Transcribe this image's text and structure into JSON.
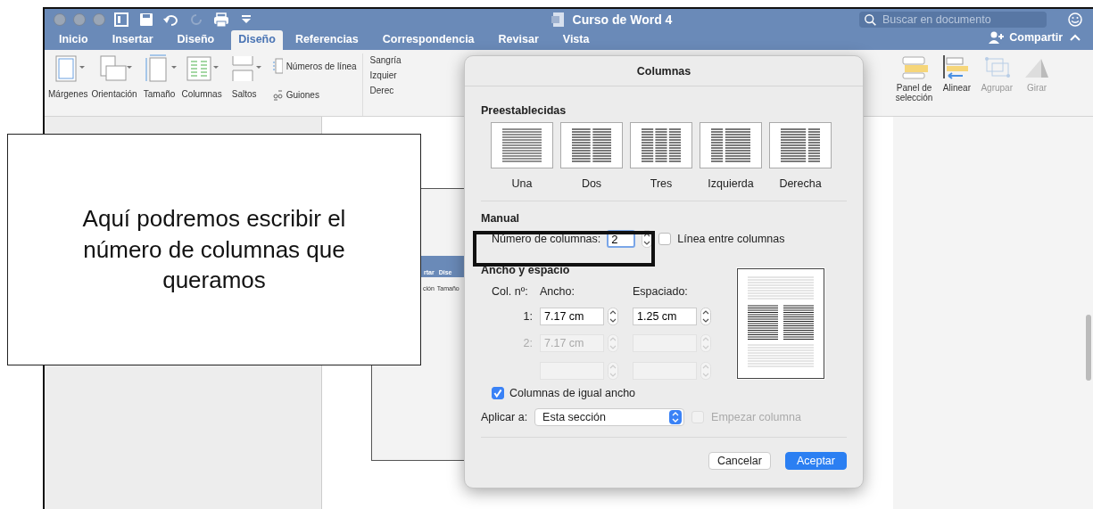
{
  "window": {
    "title": "Curso de Word 4",
    "search": {
      "placeholder": "Buscar en documento"
    },
    "share": "Compartir"
  },
  "tabs": [
    {
      "label": "Inicio",
      "selected": false
    },
    {
      "label": "Insertar",
      "selected": false
    },
    {
      "label": "Diseño",
      "selected": false
    },
    {
      "label": "Diseño",
      "selected": true
    },
    {
      "label": "Referencias",
      "selected": false
    },
    {
      "label": "Correspondencia",
      "selected": false
    },
    {
      "label": "Revisar",
      "selected": false
    },
    {
      "label": "Vista",
      "selected": false
    }
  ],
  "ribbon": {
    "large": [
      {
        "label": "Márgenes",
        "kind": "margins"
      },
      {
        "label": "Orientación",
        "kind": "orientation"
      },
      {
        "label": "Tamaño",
        "kind": "size"
      },
      {
        "label": "Columnas",
        "kind": "columns"
      },
      {
        "label": "Saltos",
        "kind": "breaks"
      }
    ],
    "small": [
      {
        "label": "Números de línea",
        "kind": "numbers"
      },
      {
        "label": "Guiones",
        "kind": "hyphen"
      }
    ],
    "indent": {
      "title": "Sangría",
      "items": [
        "Izquier",
        "Derec"
      ]
    },
    "right": [
      {
        "label": "Panel de selección",
        "kind": "panel",
        "disabled": false
      },
      {
        "label": "Alinear",
        "kind": "align",
        "disabled": false
      },
      {
        "label": "Agrupar",
        "kind": "group",
        "disabled": true
      },
      {
        "label": "Girar",
        "kind": "rotate",
        "disabled": true
      }
    ]
  },
  "inner_screenshot": {
    "tabs": [
      "rtar",
      "Dise"
    ],
    "labels": [
      "ción",
      "Tamaño"
    ]
  },
  "callout": {
    "text": "Aquí podremos escribir el número de columnas que queramos"
  },
  "dialog": {
    "title": "Columnas",
    "presets_title": "Preestablecidas",
    "presets": [
      {
        "label": "Una",
        "kind": "one"
      },
      {
        "label": "Dos",
        "kind": "two"
      },
      {
        "label": "Tres",
        "kind": "three"
      },
      {
        "label": "Izquierda",
        "kind": "left"
      },
      {
        "label": "Derecha",
        "kind": "right"
      }
    ],
    "manual_title": "Manual",
    "count_label": "Número de columnas:",
    "count": "2",
    "line_between": {
      "label": "Línea entre columnas",
      "checked": false
    },
    "size_title": "Ancho y espacio",
    "headers": [
      "Col. nº:",
      "Ancho:",
      "Espaciado:"
    ],
    "rows": [
      {
        "number": "1:",
        "width": "7.17 cm",
        "spacing": "1.25 cm",
        "disabled": false
      },
      {
        "number": "2:",
        "width": "7.17 cm",
        "disabled": true
      },
      {
        "disabled": true
      }
    ],
    "equal_width": {
      "label": "Columnas de igual ancho",
      "checked": true
    },
    "apply_label": "Aplicar a:",
    "apply_value": "Esta sección",
    "start_column": {
      "label": "Empezar columna",
      "checked": false,
      "disabled": true
    },
    "buttons": [
      {
        "label": "Cancelar",
        "kind": "secondary"
      },
      {
        "label": "Aceptar",
        "kind": "primary"
      }
    ]
  }
}
